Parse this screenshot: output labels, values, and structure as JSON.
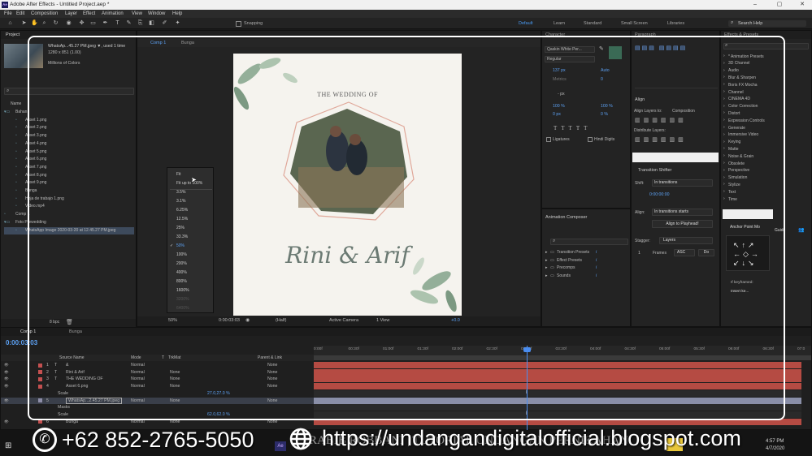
{
  "window": {
    "title": "Adobe After Effects - Untitled Project.aep *",
    "app_icon": "Ae"
  },
  "menu": [
    "File",
    "Edit",
    "Composition",
    "Layer",
    "Effect",
    "Animation",
    "View",
    "Window",
    "Help"
  ],
  "toolbar": {
    "snapping": "Snapping",
    "workspaces": [
      "Default",
      "Learn",
      "Standard",
      "Small Screen",
      "Libraries"
    ],
    "search": "Search Help"
  },
  "project": {
    "tab": "Project",
    "file_name": "WhatsAp...45.27 PM.jpeg ▼, used 1 time",
    "file_dims": "1280 x 851 (1.00)",
    "file_colors": "Millions of Colors",
    "col_name": "Name",
    "items": [
      "Bahan",
      "Asset 1.png",
      "Asset 2.png",
      "Asset 3.png",
      "Asset 4.png",
      "Asset 5.png",
      "Asset 6.png",
      "Asset 7.png",
      "Asset 8.png",
      "Asset 9.png",
      "Bunga",
      "Hoja de trabajo 1.png",
      "Video.mp4",
      "Comp 1",
      "Foto Prewedding",
      "WhatsApp Image 2020-03-20 at 12.45.27 PM.jpeg"
    ],
    "bpc": "8 bpc"
  },
  "comp": {
    "tabs": [
      "Comp 1",
      "Bunga"
    ],
    "wedding_title": "THE WEDDING OF",
    "names": "Rini & Arif",
    "zoom": "50%",
    "time": "0:00:03:03",
    "resolution": "(Half)",
    "camera": "Active Camera",
    "view": "1 View",
    "exposure": "+0.0"
  },
  "zoom_menu": {
    "items": [
      "Fit",
      "Fit up to 100%",
      "3.5%",
      "3.1%",
      "6.25%",
      "12.5%",
      "25%",
      "33.3%",
      "50%",
      "100%",
      "200%",
      "400%",
      "800%",
      "1600%",
      "3200%",
      "6400%"
    ],
    "selected": "50%"
  },
  "character": {
    "tab": "Character",
    "font": "Qaskin White Per...",
    "style": "Regular",
    "size": "137 px",
    "leading": "Auto",
    "tracking": "0",
    "metrics": "Metrics",
    "stroke_unit": "- px",
    "scale_v": "100 %",
    "scale_h": "100 %",
    "baseline": "0 px",
    "tsume": "0 %",
    "ligatures": "Ligatures",
    "hindi": "Hindi Digits"
  },
  "paragraph": {
    "tab": "Paragraph"
  },
  "align": {
    "tab": "Align",
    "align_to_label": "Align Layers to:",
    "align_to": "Composition",
    "distribute": "Distribute Layers:"
  },
  "transition": {
    "tab": "Transition Shifter",
    "shift_label": "Shift:",
    "shift": "In transitions",
    "time": "0:00:00:00",
    "align_label": "Align:",
    "align": "In transitions starts",
    "align_btn": "Align to Playhead!",
    "stagger_label": "Stagger:",
    "stagger": "Layers",
    "frames_val": "1",
    "frames": "Frames",
    "order": "ASC",
    "do": "Do"
  },
  "animation_composer": {
    "tab": "Animation Composer",
    "items": [
      "Transition Presets",
      "Effect Presets",
      "Precomps",
      "Sounds"
    ]
  },
  "effects": {
    "tab": "Effects & Presets",
    "items": [
      "* Animation Presets",
      "3D Channel",
      "Audio",
      "Blur & Sharpen",
      "Boris FX Mocha",
      "Channel",
      "CINEMA 4D",
      "Color Correction",
      "Distort",
      "Expression Controls",
      "Generate",
      "Immersive Video",
      "Keying",
      "Matte",
      "Noise & Grain",
      "Obsolete",
      "Perspective",
      "Simulation",
      "Stylize",
      "Text",
      "Time"
    ]
  },
  "anchor": {
    "title": "Anchor Point Mo",
    "guide": "Guide",
    "keyframed": "If keyframed:",
    "insert": "Insert ke..."
  },
  "timeline": {
    "tabs": [
      "Comp 1",
      "Bunga"
    ],
    "time": "0:00:03:03",
    "headers": {
      "source": "Source Name",
      "mode": "Mode",
      "t": "T",
      "trkmat": "TrkMat",
      "parent": "Parent & Link"
    },
    "ticks": [
      "0:00f",
      "00:30f",
      "01:00f",
      "01:30f",
      "02:00f",
      "02:30f",
      "03:00f",
      "03:30f",
      "04:00f",
      "04:30f",
      "05:00f",
      "05:30f",
      "06:00f",
      "06:30f",
      "07:0"
    ],
    "layers": [
      {
        "num": "1",
        "type": "T",
        "name": "&",
        "mode": "Normal",
        "trk": "",
        "parent": "None"
      },
      {
        "num": "2",
        "type": "T",
        "name": "Rini & Arif",
        "mode": "Normal",
        "trk": "None",
        "parent": "None"
      },
      {
        "num": "3",
        "type": "T",
        "name": "THE WEDDING OF",
        "mode": "Normal",
        "trk": "None",
        "parent": "None"
      },
      {
        "num": "4",
        "type": "",
        "name": "Asset 6.png",
        "mode": "Normal",
        "trk": "None",
        "parent": "None"
      },
      {
        "num": "",
        "type": "",
        "name": "Scale",
        "mode": "",
        "trk": "",
        "parent": ""
      },
      {
        "num": "5",
        "type": "",
        "name": "WhatsAp...2.45.27 PM.jpeg",
        "mode": "Normal",
        "trk": "None",
        "parent": "None"
      },
      {
        "num": "",
        "type": "",
        "name": "Masks",
        "mode": "",
        "trk": "",
        "parent": ""
      },
      {
        "num": "",
        "type": "",
        "name": "Scale",
        "mode": "",
        "trk": "",
        "parent": ""
      },
      {
        "num": "6",
        "type": "",
        "name": "Bunga",
        "mode": "Normal",
        "trk": "None",
        "parent": "None"
      }
    ],
    "scale_values": [
      "27.0,27.0 %",
      "62.0,62.0 %"
    ]
  },
  "overlay": {
    "phone": "+62 852-2765-5050",
    "url": "https://undangandigitalofficial.blogspot.com",
    "banner": "RABIB ROBBANI | TUTORIAL UNDANGAN PERNIKAHAN"
  },
  "taskbar": {
    "time": "4:57 PM",
    "date": "4/7/2020"
  }
}
